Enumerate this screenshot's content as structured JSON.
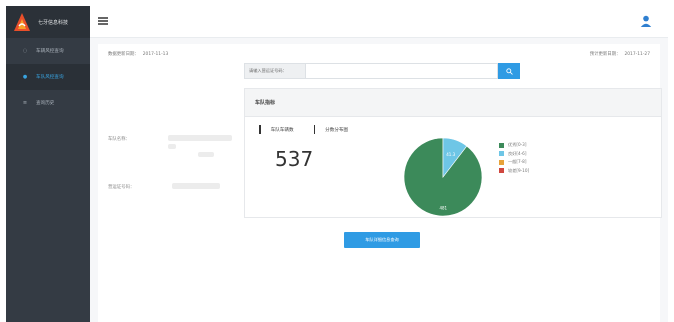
{
  "app": {
    "name": "七牙信息科技"
  },
  "sidebar": {
    "items": [
      {
        "label": "车辆风控查询",
        "icon": "car-icon",
        "active": false
      },
      {
        "label": "车队风控查询",
        "icon": "dot-icon",
        "active": true
      },
      {
        "label": "查询历史",
        "icon": "list-icon",
        "active": false
      }
    ]
  },
  "header": {
    "menu_icon": "menu-icon",
    "user_icon": "user-icon"
  },
  "main": {
    "data_update_label": "数据更新日期：",
    "data_update_date": "2017-11-13",
    "expected_update_label": "预计更新日期：",
    "expected_update_date": "2017-11-27",
    "search": {
      "addon_label": "请输入营运证号码：",
      "placeholder": "",
      "button_icon": "search-icon"
    },
    "fleet_name_label": "车队名称：",
    "license_label": "营运证号码：",
    "indicator": {
      "title": "车队指标",
      "tabs": [
        "车队车辆数",
        "分数分布图"
      ],
      "vehicle_count": "537",
      "pie": {
        "slice1_label": "481",
        "slice2_label": "41.3"
      },
      "legend": [
        {
          "label": "优秀[0-3]",
          "color": "#3c8a5a"
        },
        {
          "label": "良好[4-6]",
          "color": "#6ec6e6"
        },
        {
          "label": "一般[7-8]",
          "color": "#e7a33a"
        },
        {
          "label": "较差[9-10]",
          "color": "#d0473f"
        }
      ]
    },
    "detail_button_label": "车队详细信息查询",
    "colors": {
      "accent": "#2f9be4",
      "sidebar": "#343b44",
      "active": "#38a3e0"
    }
  },
  "chart_data": {
    "type": "pie",
    "categories": [
      "优秀[0-3]",
      "良好[4-6]",
      "一般[7-8]",
      "较差[9-10]"
    ],
    "values": [
      481,
      56,
      0,
      0
    ],
    "title": "",
    "data_labels": [
      "481",
      "41.3"
    ]
  }
}
